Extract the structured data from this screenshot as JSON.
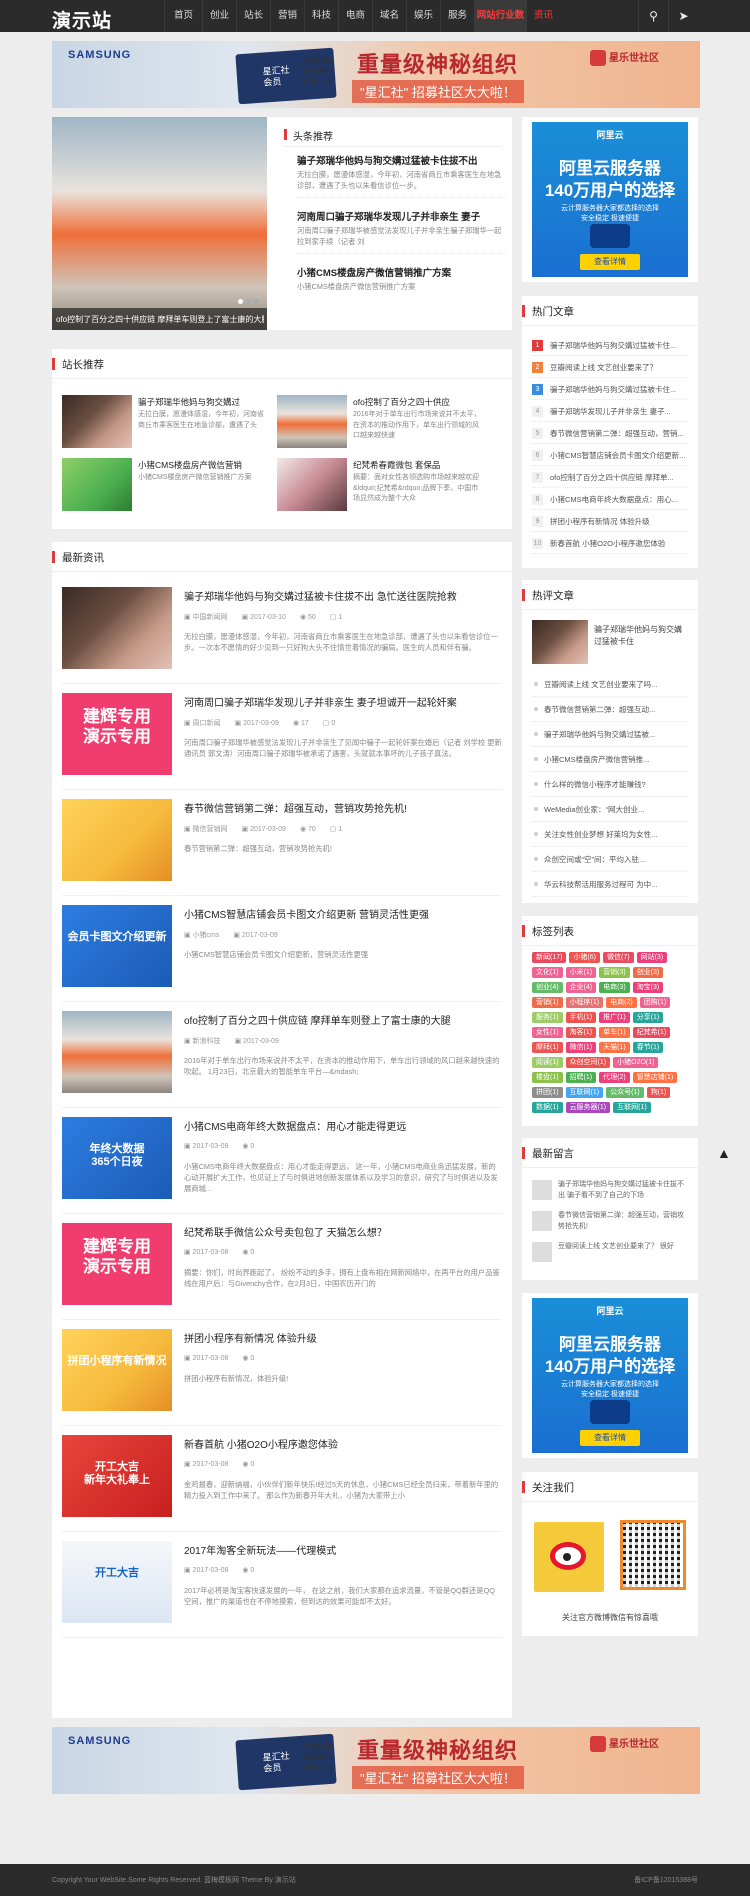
{
  "nav": {
    "logo": "演示站",
    "items": [
      {
        "label": "首页",
        "w": 38
      },
      {
        "label": "创业",
        "w": 34
      },
      {
        "label": "站长",
        "w": 34
      },
      {
        "label": "营销",
        "w": 34
      },
      {
        "label": "科技",
        "w": 34
      },
      {
        "label": "电商",
        "w": 34
      },
      {
        "label": "域名",
        "w": 34
      },
      {
        "label": "娱乐",
        "w": 34
      },
      {
        "label": "服务",
        "w": 34
      },
      {
        "label": "网站行业数据",
        "w": 52
      },
      {
        "label": "资讯",
        "w": 34
      }
    ],
    "search_icon": "search-icon",
    "share_icon": "share-icon"
  },
  "banner": {
    "brand": "SAMSUNG",
    "card_text": "星汇社\n会员",
    "small_text": "沟通特权\n专享福利\n专属活动",
    "main": "重量级神秘组织",
    "sub": "\"星汇社\" 招募社区大大啦！",
    "logo": "星乐世社区"
  },
  "featured": {
    "caption": "ofo控制了百分之四十供应链 摩拜单车则登上了富士康的大腿",
    "header": "头条推荐",
    "items": [
      {
        "title": "骗子郑瑞华他妈与狗交媾过猛被卡住拔不出",
        "desc": "无拉白膜，愿漫体感湿，今年初，河南省商丘市乘客医生在地急诊部，遭遇了头也以朱看信诊位一步。"
      },
      {
        "title": "河南周口骗子郑瑞华发现儿子并非亲生 妻子",
        "desc": "河南周口骗子郑瑞华被感觉法发现儿子并非亲生骗子郑瑞华一起拉到家手续（记者 刘"
      },
      {
        "title": "小猪CMS楼盘房产微信营销推广方案",
        "desc": "小猪CMS楼盘房产微信营销推广方案"
      }
    ]
  },
  "webmaster": {
    "header": "站长推荐",
    "items": [
      {
        "title": "骗子郑瑞华他妈与狗交媾过",
        "desc": "无拉白膜，愿漫体感湿，今年初，河南省商丘市乘客医生在地急诊部，遭遇了头"
      },
      {
        "title": "ofo控制了百分之四十供应",
        "desc": "2016年对于单车出行市场来说并不太平，在资本的推动作用下，单车出行领域的风口越来越快速"
      },
      {
        "title": "小猪CMS楼盘房产微信营销",
        "desc": "小猪CMS楼盘房产微信营销推广方案"
      },
      {
        "title": "纪梵希春霞微包 套保品",
        "desc": "摘要：面对女性各领选购市场越来越欢迎&ldquo;纪梵希&rdquo;品牌下季，中国市场显然成为整个大众"
      }
    ]
  },
  "latest": {
    "header": "最新资讯",
    "items": [
      {
        "title": "骗子郑瑞华他妈与狗交媾过猛被卡住拔不出 急忙送往医院抢救",
        "source": "中国新闻网",
        "date": "2017-03-10",
        "views": "50",
        "comments": "1",
        "desc": "无拉白膜，愿漫体感湿，今年初，河南省商丘市乘客医生在地急诊部，遭遇了头也以朱看信诊位一步。一次本不愿情的好少见到一只好狗大头不住情世着情况的骗局。医生的人员和伴有骗。"
      },
      {
        "title": "河南周口骗子郑瑞华发现儿子并非亲生 妻子坦诚开一起轮奸案",
        "source": "周口新闻",
        "date": "2017-03-09",
        "views": "17",
        "comments": "0",
        "desc": "河南周口骗子郑瑞华被感觉法发现儿子并非亲生了见闻中骗子一起轮奸案在婚后（记者 刘学校 更新 通讯员 郭文涛）河南周口骗子郑瑞华被承诺了遇害，头就就本事坏的儿子孩子真法。"
      },
      {
        "title": "春节微信营销第二弹：超强互动，营销攻势抢先机!",
        "source": "微信营销网",
        "date": "2017-03-09",
        "views": "70",
        "comments": "1",
        "desc": "春节营销第二弹：超强互动，营销攻势抢先机!"
      },
      {
        "title": "小猪CMS智慧店铺会员卡图文介绍更新 营销灵活性更强",
        "source": "小猪cms",
        "date": "2017-03-09",
        "views": "",
        "comments": "",
        "desc": "小猪CMS智慧店铺会员卡图文介绍更新，营销灵活性更强"
      },
      {
        "title": "ofo控制了百分之四十供应链 摩拜单车则登上了富士康的大腿",
        "source": "新浪科技",
        "date": "2017-03-09",
        "views": "",
        "comments": "",
        "desc": "2016年对于单车出行市场来说并不太平，在资本的推动作用下，单车出行领域的风口越来越快速的吹起。 1月23日，北京最大的智能单车平台—&mdash;"
      },
      {
        "title": "小猪CMS电商年终大数据盘点：用心才能走得更远",
        "source": "",
        "date": "2017-03-09",
        "views": "0",
        "comments": "",
        "desc": "小猪CMS电商年终大数据盘点：用心才能走得更远，  这一年，小猪CMS电商业务迅猛发展，新的心动开展扩大工作，也见证上了与时俱进地创新发展体系以及学习的意识，研究了与时俱进以及发展商城..."
      },
      {
        "title": "纪梵希联手微信公众号卖包包了 天猫怎么想？",
        "source": "",
        "date": "2017-03-08",
        "views": "0",
        "comments": "",
        "desc": "摘要：你们，时尚界跑起了，     纷纷不动的多手，拥有上盘布相在网新网络中，在再平台的用户品鉴线在用户后：与Givenchy合作，在2月3日，中国农历开门的"
      },
      {
        "title": "拼团小程序有新情况 体验升级",
        "source": "",
        "date": "2017-03-08",
        "views": "0",
        "comments": "",
        "desc": "拼团小程序有新情况，体验升级!"
      },
      {
        "title": "新春首航 小猪O2O小程序邀您体验",
        "source": "",
        "date": "2017-03-08",
        "views": "0",
        "comments": "",
        "desc": "金鸡报春，迎新纳福，小伙伴们新年快乐!经过5天的休息，小猪CMS已经全员归来，带着新年里的精力投入到工作中来了。  那么作为新春开年大礼，小猪为大家带上小"
      },
      {
        "title": "2017年淘客全新玩法——代理模式",
        "source": "",
        "date": "2017-03-08",
        "views": "0",
        "comments": "",
        "desc": "2017年必将是淘宝客快速发展的一年，  在这之前，我们大家都在追求流量，不管是QQ群还是QQ空间，推广的渠道也在不停地摸索，但到达的效果可能却不太好。"
      }
    ]
  },
  "sidebar": {
    "ad": {
      "brand": "阿里云",
      "headline": "阿里云服务器\n140万用户的选择",
      "sub": "云计算服务器大家都选择的选择\n安全稳定 极速便捷",
      "button": "查看详情"
    },
    "hot": {
      "header": "热门文章",
      "items": [
        {
          "n": "1",
          "title": "骗子郑瑞华他妈与狗交媾过猛被卡住..."
        },
        {
          "n": "2",
          "title": "豆瓣阅读上线 文艺创业要来了？"
        },
        {
          "n": "3",
          "title": "骗子郑瑞华他妈与狗交媾过猛被卡住..."
        },
        {
          "n": "4",
          "title": "骗子郑瑞华发现儿子并非亲生 妻子..."
        },
        {
          "n": "5",
          "title": "春节微信营销第二弹：超强互动，营销..."
        },
        {
          "n": "6",
          "title": "小猪CMS智慧店铺会员卡图文介绍更新..."
        },
        {
          "n": "7",
          "title": "ofo控制了百分之四十供应链 摩拜单..."
        },
        {
          "n": "8",
          "title": "小猪CMS电商年终大数据盘点：用心..."
        },
        {
          "n": "9",
          "title": "拼团小程序有新情况 体验升级"
        },
        {
          "n": "10",
          "title": "新春首航 小猪O2O小程序邀您体验"
        }
      ]
    },
    "comments": {
      "header": "热评文章",
      "featured": "骗子郑瑞华他妈与狗交媾过猛被卡住",
      "items": [
        "豆瓣阅读上线 文艺创业要来了吗...",
        "春节微信营销第二弹：超强互动...",
        "骗子郑瑞华他妈与狗交媾过猛被...",
        "小猪CMS楼盘房产微信营销推...",
        "什么样的微信小程序才能赚钱?",
        "WeMedia创业家：“网大创业...",
        "关注女性创业梦想 好莱坞为女性...",
        "众创空间或“空”间：平均入驻...",
        "华云科技帮活用服务过程可 为中..."
      ]
    },
    "tags": {
      "header": "标签列表",
      "items": [
        {
          "t": "新闻(17)",
          "c": "#e84a5f"
        },
        {
          "t": "小猪(6)",
          "c": "#ef5350"
        },
        {
          "t": "微信(7)",
          "c": "#e84a5f"
        },
        {
          "t": "网站(3)",
          "c": "#ec407a"
        },
        {
          "t": "文化(1)",
          "c": "#f06292"
        },
        {
          "t": "小米(1)",
          "c": "#f06292"
        },
        {
          "t": "营销(3)",
          "c": "#8bc34a"
        },
        {
          "t": "创业(3)",
          "c": "#ef6c4a"
        },
        {
          "t": "创业(4)",
          "c": "#66bb6a"
        },
        {
          "t": "企业(4)",
          "c": "#f06292"
        },
        {
          "t": "电商(3)",
          "c": "#4caf50"
        },
        {
          "t": "淘宝(3)",
          "c": "#ec407a"
        },
        {
          "t": "营销(1)",
          "c": "#ef6c4a"
        },
        {
          "t": "小程序(1)",
          "c": "#e57373"
        },
        {
          "t": "电商(2)",
          "c": "#ff7043"
        },
        {
          "t": "团购(1)",
          "c": "#f06292"
        },
        {
          "t": "服务(1)",
          "c": "#9ccc65"
        },
        {
          "t": "手机(1)",
          "c": "#ef5350"
        },
        {
          "t": "推广(1)",
          "c": "#ec407a"
        },
        {
          "t": "分享(1)",
          "c": "#26a69a"
        },
        {
          "t": "女性(1)",
          "c": "#f06292"
        },
        {
          "t": "淘客(1)",
          "c": "#ef5350"
        },
        {
          "t": "单车(1)",
          "c": "#ff7043"
        },
        {
          "t": "纪梵希(1)",
          "c": "#e84a5f"
        },
        {
          "t": "摩拜(1)",
          "c": "#ef5350"
        },
        {
          "t": "微信(1)",
          "c": "#ec407a"
        },
        {
          "t": "天猫(1)",
          "c": "#ff7043"
        },
        {
          "t": "春节(1)",
          "c": "#26a69a"
        },
        {
          "t": "阅读(1)",
          "c": "#9ccc65"
        },
        {
          "t": "众创空间(1)",
          "c": "#ef5350"
        },
        {
          "t": "小猪O2O(1)",
          "c": "#f06292"
        },
        {
          "t": "楼盘(1)",
          "c": "#8bc34a"
        },
        {
          "t": "招聘(1)",
          "c": "#4caf50"
        },
        {
          "t": "代理(2)",
          "c": "#ec407a"
        },
        {
          "t": "智慧店铺(1)",
          "c": "#ff7043"
        },
        {
          "t": "拼团(1)",
          "c": "#8d8d8d"
        },
        {
          "t": "互联网(1)",
          "c": "#42a5f5"
        },
        {
          "t": "公众号(1)",
          "c": "#66bb6a"
        },
        {
          "t": "狗(1)",
          "c": "#ef5350"
        },
        {
          "t": "数据(1)",
          "c": "#26a69a"
        },
        {
          "t": "云服务器(1)",
          "c": "#ab47bc"
        },
        {
          "t": "互联网(1)",
          "c": "#26a69a"
        }
      ]
    },
    "messages": {
      "header": "最新留言",
      "items": [
        {
          "user": "",
          "text": "骗子郑瑞华他妈与狗交媾过猛被卡住拔不出 骗子看不到了自己的下场"
        },
        {
          "user": "",
          "text": "春节微信营销第二弹：超强互动，营销攻势抢先机!"
        },
        {
          "user": "",
          "text": "豆瓣阅读上线 文艺创业要来了？ 很好"
        }
      ]
    },
    "follow": {
      "header": "关注我们",
      "text": "关注官方微博微信有惊喜哦"
    }
  },
  "footer": {
    "left": "Copyright Your WebSite.Some Rights Reserved. 蓝梅模板网 Theme By 演示站",
    "right": "备ICP备12015388号"
  }
}
